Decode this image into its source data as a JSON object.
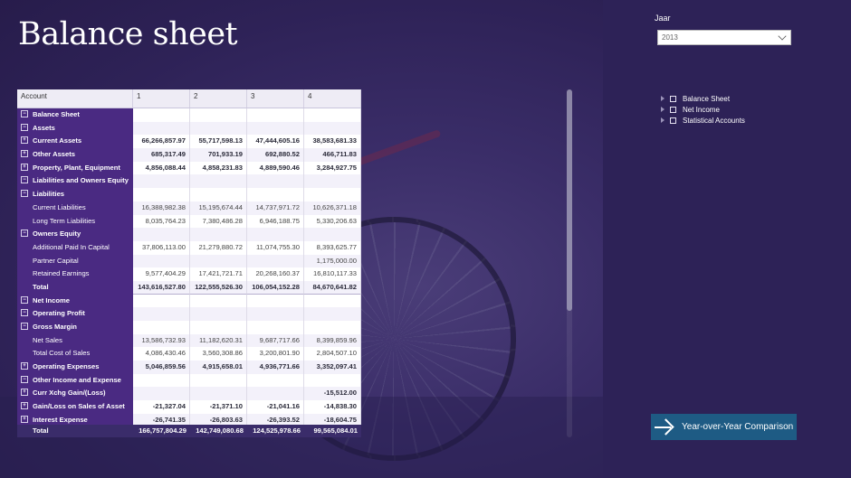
{
  "title": "Balance sheet",
  "slicer": {
    "label": "Jaar",
    "selected": "2013"
  },
  "tree": [
    "Balance Sheet",
    "Net Income",
    "Statistical Accounts"
  ],
  "yoy_button": "Year-over-Year Comparison",
  "matrix": {
    "headers": [
      "Account",
      "1",
      "2",
      "3",
      "4"
    ],
    "rows": [
      {
        "label": "Balance Sheet",
        "level": 0,
        "bold": true,
        "expander": "−",
        "values": [
          "",
          "",
          "",
          ""
        ]
      },
      {
        "label": "Assets",
        "level": 0,
        "bold": true,
        "expander": "−",
        "values": [
          "",
          "",
          "",
          ""
        ]
      },
      {
        "label": "Current Assets",
        "level": 0,
        "bold": true,
        "expander": "+",
        "values": [
          "66,266,857.97",
          "55,717,598.13",
          "47,444,605.16",
          "38,583,681.33"
        ]
      },
      {
        "label": "Other Assets",
        "level": 0,
        "bold": true,
        "expander": "+",
        "values": [
          "685,317.49",
          "701,933.19",
          "692,880.52",
          "466,711.83"
        ]
      },
      {
        "label": "Property, Plant, Equipment",
        "level": 0,
        "bold": true,
        "expander": "+",
        "values": [
          "4,856,088.44",
          "4,858,231.83",
          "4,889,590.46",
          "3,284,927.75"
        ]
      },
      {
        "label": "Liabilities and Owners Equity",
        "level": 0,
        "bold": true,
        "expander": "−",
        "values": [
          "",
          "",
          "",
          ""
        ]
      },
      {
        "label": "Liabilities",
        "level": 0,
        "bold": true,
        "expander": "−",
        "values": [
          "",
          "",
          "",
          ""
        ]
      },
      {
        "label": "Current Liabilities",
        "level": 1,
        "bold": false,
        "expander": "",
        "values": [
          "16,388,982.38",
          "15,195,674.44",
          "14,737,971.72",
          "10,626,371.18"
        ]
      },
      {
        "label": "Long Term Liabilities",
        "level": 1,
        "bold": false,
        "expander": "",
        "values": [
          "8,035,764.23",
          "7,380,486.28",
          "6,946,188.75",
          "5,330,206.63"
        ]
      },
      {
        "label": "Owners Equity",
        "level": 0,
        "bold": true,
        "expander": "−",
        "values": [
          "",
          "",
          "",
          ""
        ]
      },
      {
        "label": "Additional Paid In Capital",
        "level": 1,
        "bold": false,
        "expander": "",
        "values": [
          "37,806,113.00",
          "21,279,880.72",
          "11,074,755.30",
          "8,393,625.77"
        ]
      },
      {
        "label": "Partner Capital",
        "level": 1,
        "bold": false,
        "expander": "",
        "values": [
          "",
          "",
          "",
          "1,175,000.00"
        ]
      },
      {
        "label": "Retained Earnings",
        "level": 1,
        "bold": false,
        "expander": "",
        "values": [
          "9,577,404.29",
          "17,421,721.71",
          "20,268,160.37",
          "16,810,117.33"
        ]
      },
      {
        "label": "Total",
        "level": 1,
        "bold": true,
        "expander": "",
        "values": [
          "143,616,527.80",
          "122,555,526.30",
          "106,054,152.28",
          "84,670,641.82"
        ]
      },
      {
        "label": "Net Income",
        "level": 0,
        "bold": true,
        "expander": "−",
        "values": [
          "",
          "",
          "",
          ""
        ]
      },
      {
        "label": "Operating Profit",
        "level": 0,
        "bold": true,
        "expander": "−",
        "values": [
          "",
          "",
          "",
          ""
        ]
      },
      {
        "label": "Gross Margin",
        "level": 0,
        "bold": true,
        "expander": "−",
        "values": [
          "",
          "",
          "",
          ""
        ]
      },
      {
        "label": "Net Sales",
        "level": 1,
        "bold": false,
        "expander": "",
        "values": [
          "13,586,732.93",
          "11,182,620.31",
          "9,687,717.66",
          "8,399,859.96"
        ]
      },
      {
        "label": "Total Cost of Sales",
        "level": 1,
        "bold": false,
        "expander": "",
        "values": [
          "4,086,430.46",
          "3,560,308.86",
          "3,200,801.90",
          "2,804,507.10"
        ]
      },
      {
        "label": "Operating Expenses",
        "level": 0,
        "bold": true,
        "expander": "+",
        "values": [
          "5,046,859.56",
          "4,915,658.01",
          "4,936,771.66",
          "3,352,097.41"
        ]
      },
      {
        "label": "Other Income and Expense",
        "level": 0,
        "bold": true,
        "expander": "−",
        "values": [
          "",
          "",
          "",
          ""
        ]
      },
      {
        "label": "Curr Xchg Gain/(Loss)",
        "level": 0,
        "bold": true,
        "expander": "+",
        "values": [
          "",
          "",
          "",
          "-15,512.00"
        ]
      },
      {
        "label": "Gain/Loss on Sales of Asset",
        "level": 0,
        "bold": true,
        "expander": "+",
        "values": [
          "-21,327.04",
          "-21,371.10",
          "-21,041.16",
          "-14,838.30"
        ]
      },
      {
        "label": "Interest Expense",
        "level": 0,
        "bold": true,
        "expander": "+",
        "values": [
          "-26,741.35",
          "-26,803.63",
          "-26,393.52",
          "-18,604.75"
        ]
      }
    ],
    "total": {
      "label": "Total",
      "values": [
        "166,757,804.29",
        "142,749,080.68",
        "124,525,978.66",
        "99,565,084.01"
      ]
    }
  }
}
